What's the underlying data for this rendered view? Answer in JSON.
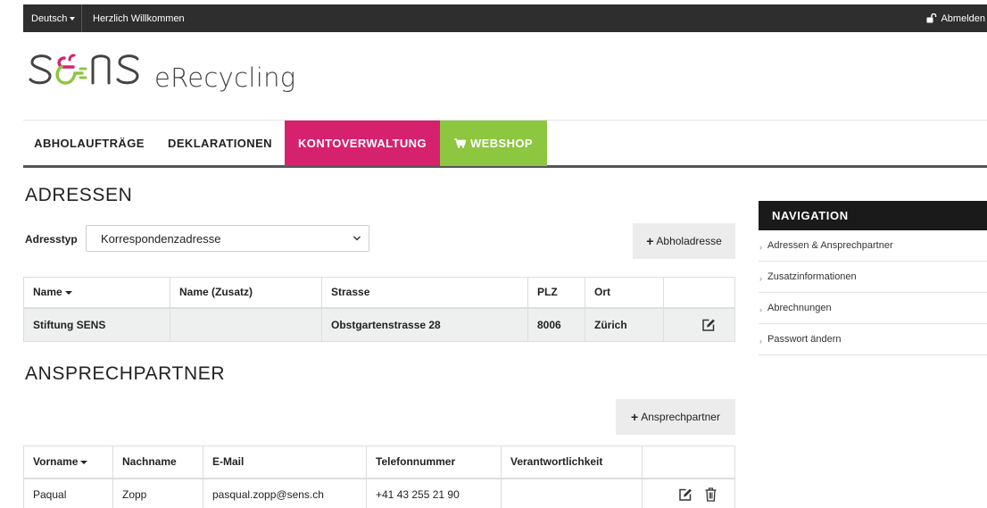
{
  "topbar": {
    "language": "Deutsch",
    "welcome": "Herzlich Willkommen",
    "logout": "Abmelden",
    "logout_icon": "unlock-icon"
  },
  "logo": {
    "sub": "eRecycling",
    "colors": {
      "magenta": "#d6216e",
      "green": "#8dc63f",
      "gray": "#444444"
    }
  },
  "mainnav": {
    "items": [
      {
        "label": "ABHOLAUFTRÄGE"
      },
      {
        "label": "DEKLARATIONEN"
      },
      {
        "label": "KONTOVERWALTUNG",
        "active": true,
        "color": "#d6216e"
      },
      {
        "label": "WEBSHOP",
        "icon": "cart-icon",
        "color": "#8dc63f"
      }
    ]
  },
  "addresses": {
    "title": "ADRESSEN",
    "type_label": "Adresstyp",
    "type_value": "Korrespondenzadresse",
    "add_button": "Abholadresse",
    "columns": [
      "Name",
      "Name (Zusatz)",
      "Strasse",
      "PLZ",
      "Ort",
      ""
    ],
    "rows": [
      {
        "name": "Stiftung SENS",
        "name_extra": "",
        "street": "Obstgartenstrasse 28",
        "zip": "8006",
        "city": "Zürich"
      }
    ]
  },
  "contacts": {
    "title": "ANSPRECHPARTNER",
    "add_button": "Ansprechpartner",
    "columns": [
      "Vorname",
      "Nachname",
      "E-Mail",
      "Telefonnummer",
      "Verantwortlichkeit",
      ""
    ],
    "rows": [
      {
        "first": "Paqual",
        "last": "Zopp",
        "email": "pasqual.zopp@sens.ch",
        "phone": "+41 43 255 21 90",
        "responsibility": ""
      }
    ]
  },
  "sidebar": {
    "title": "NAVIGATION",
    "items": [
      {
        "label": "Adressen & Ansprechpartner"
      },
      {
        "label": "Zusatzinformationen"
      },
      {
        "label": "Abrechnungen"
      },
      {
        "label": "Passwort ändern"
      }
    ]
  }
}
